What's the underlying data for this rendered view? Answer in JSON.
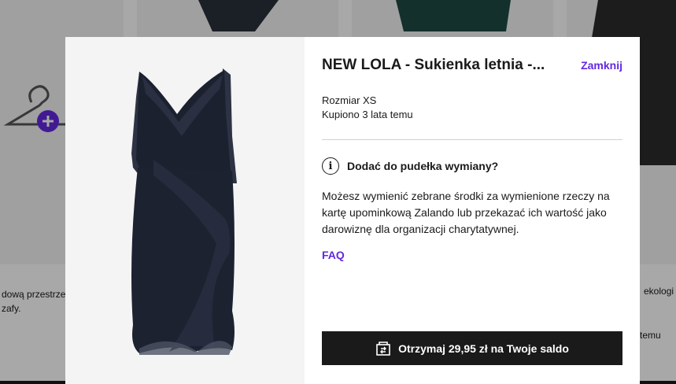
{
  "background": {
    "card1_text_line1": "dową przestrzeń",
    "card1_text_line2": "zafy.",
    "card4_text_line1": "ekologi",
    "card4_text_line2": "temu"
  },
  "modal": {
    "title": "NEW LOLA - Sukienka letnia -...",
    "close_label": "Zamknij",
    "size": "Rozmiar XS",
    "purchased": "Kupiono 3 lata temu",
    "info_title": "Dodać do pudełka wymiany?",
    "description": "Możesz wymienić zebrane środki za wymienione rzeczy na kartę upominkową Zalando lub przekazać ich wartość jako darowiznę dla organizacji charytatywnej.",
    "faq_label": "FAQ",
    "cta_label": "Otrzymaj 29,95 zł na Twoje saldo",
    "cta_icon": "exchange-box-icon",
    "info_icon": "info-icon",
    "image_icon": "dress-product-image"
  },
  "colors": {
    "accent": "#6328e0",
    "cta_bg": "#1a1a1a",
    "overlay": "rgba(0,0,0,0.34)"
  }
}
